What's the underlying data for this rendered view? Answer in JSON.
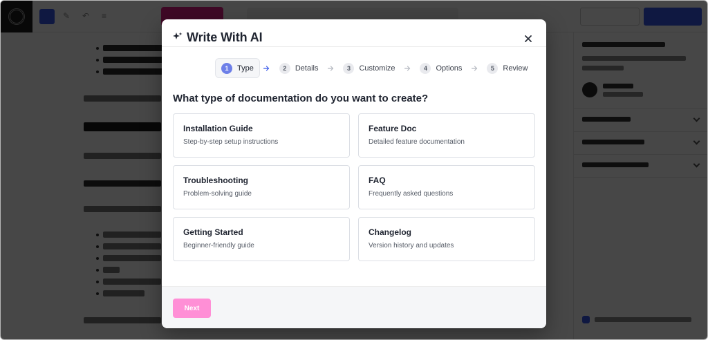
{
  "modal": {
    "title": "Write With AI",
    "title_icon": "sparkle-icon",
    "close_icon": "close-icon",
    "steps": [
      {
        "number": "1",
        "label": "Type",
        "active": true
      },
      {
        "number": "2",
        "label": "Details",
        "active": false
      },
      {
        "number": "3",
        "label": "Customize",
        "active": false
      },
      {
        "number": "4",
        "label": "Options",
        "active": false
      },
      {
        "number": "5",
        "label": "Review",
        "active": false
      }
    ],
    "question": "What type of documentation do you want to create?",
    "options": [
      {
        "title": "Installation Guide",
        "description": "Step-by-step setup instructions"
      },
      {
        "title": "Feature Doc",
        "description": "Detailed feature documentation"
      },
      {
        "title": "Troubleshooting",
        "description": "Problem-solving guide"
      },
      {
        "title": "FAQ",
        "description": "Frequently asked questions"
      },
      {
        "title": "Getting Started",
        "description": "Beginner-friendly guide"
      },
      {
        "title": "Changelog",
        "description": "Version history and updates"
      }
    ],
    "next_label": "Next"
  },
  "colors": {
    "overlay": "#000000",
    "accent_step": "#6d7fe8",
    "next_button": "#ff8fd6",
    "editor_accent": "#3858e9",
    "brand_pink": "#e0218a"
  }
}
